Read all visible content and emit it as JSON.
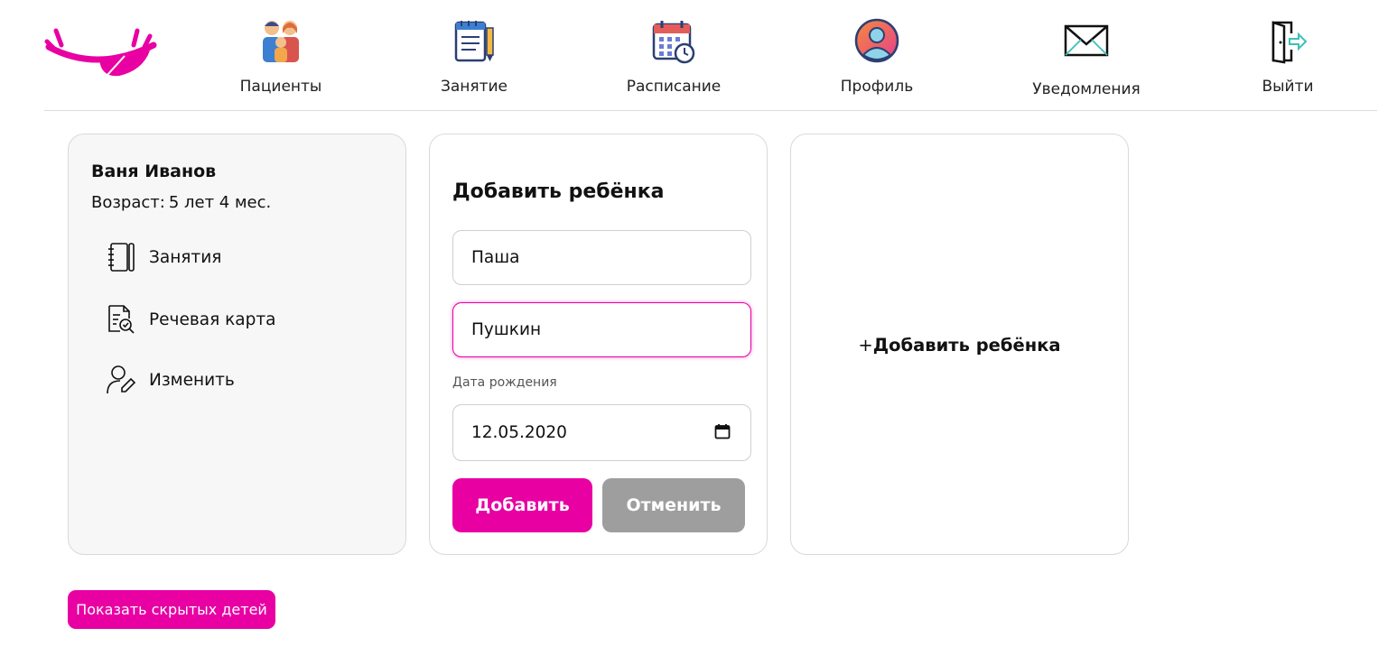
{
  "colors": {
    "accent": "#e800a3",
    "cancel": "#9e9e9e",
    "card_bg": "#f7f7f7"
  },
  "logo": {
    "icon": "winking-eye-logo"
  },
  "nav": [
    {
      "label": "Пациенты",
      "icon": "family-icon"
    },
    {
      "label": "Занятие",
      "icon": "notepad-pencil-icon"
    },
    {
      "label": "Расписание",
      "icon": "calendar-clock-icon"
    },
    {
      "label": "Профиль",
      "icon": "user-avatar-icon"
    },
    {
      "label": "Уведомления",
      "icon": "envelope-icon"
    },
    {
      "label": "Выйти",
      "icon": "logout-door-icon"
    }
  ],
  "child_card": {
    "name": "Ваня Иванов",
    "age_label": "Возраст:",
    "age_value": "5 лет 4 мес.",
    "menu": [
      {
        "label": "Занятия",
        "icon": "notebook-icon"
      },
      {
        "label": "Речевая карта",
        "icon": "document-search-icon"
      },
      {
        "label": "Изменить",
        "icon": "user-edit-icon"
      }
    ]
  },
  "form": {
    "title": "Добавить ребёнка",
    "first_name": "Паша",
    "last_name": "Пушкин",
    "birth_label": "Дата рождения",
    "birth_date": "12.05.2020",
    "add_button": "Добавить",
    "cancel_button": "Отменить"
  },
  "add_card": {
    "plus": "+",
    "label": "Добавить ребёнка"
  },
  "show_hidden_button": "Показать скрытых детей"
}
